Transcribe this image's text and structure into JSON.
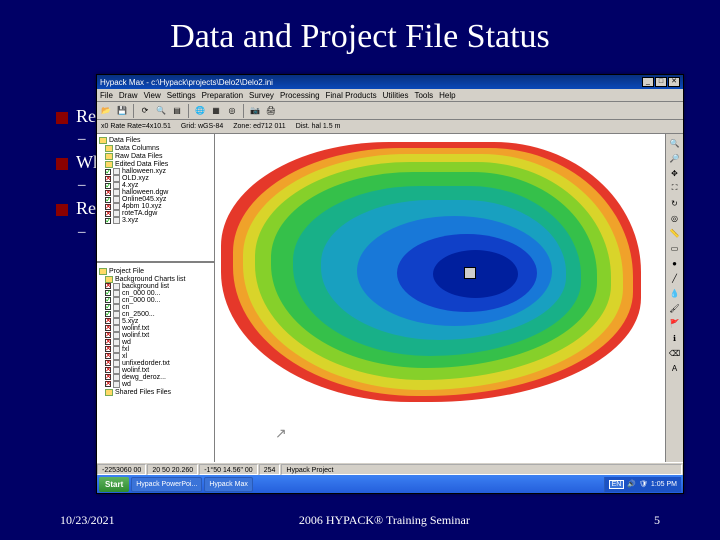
{
  "slide": {
    "title": "Data and Project File Status",
    "b1": "Red",
    "s1": "–",
    "b2": "Whi",
    "s2": "–",
    "b3": "Red",
    "s3": "–",
    "date": "10/23/2021",
    "seminar": "2006 HYPACK® Training Seminar",
    "page": "5"
  },
  "app": {
    "title": "Hypack Max - c:\\Hypack\\projects\\Delo2\\Delo2.ini",
    "menu": [
      "File",
      "Draw",
      "View",
      "Settings",
      "Preparation",
      "Survey",
      "Processing",
      "Final Products",
      "Utilities",
      "Tools",
      "Help"
    ],
    "status": {
      "s1": "x0   Rate Rate=4x10.51",
      "s2": "Grid: wGS-84",
      "s3": "Zone: ed712   011",
      "s4": "Dist. hal 1.5 m"
    },
    "tree1": {
      "root": "Data Files",
      "folders": [
        "Data Columns",
        "Raw Data Files",
        "Edited Data Files"
      ],
      "items": [
        {
          "chk": "green",
          "name": "halloween.xyz"
        },
        {
          "chk": "red",
          "name": "OLD.xyz"
        },
        {
          "chk": "green",
          "name": "4.xyz"
        },
        {
          "chk": "red",
          "name": "halloween.dgw"
        },
        {
          "chk": "green",
          "name": "Online045.xyz"
        },
        {
          "chk": "red",
          "name": "4pbm 10.xyz"
        },
        {
          "chk": "red",
          "name": "roteTA.dgw"
        },
        {
          "chk": "green",
          "name": "3.xyz"
        }
      ]
    },
    "tree2": {
      "root": "Project File",
      "folder": "Background Charts list",
      "items": [
        {
          "chk": "red",
          "name": "background list"
        },
        {
          "chk": "green",
          "name": "cn_000 00..."
        },
        {
          "chk": "green",
          "name": "cn_000 00..."
        },
        {
          "chk": "green",
          "name": "cn"
        },
        {
          "chk": "green",
          "name": "cn_2500..."
        },
        {
          "chk": "red",
          "name": "5.xyz"
        },
        {
          "chk": "red",
          "name": "wolinf.txt"
        },
        {
          "chk": "red",
          "name": "wolinf.txt"
        },
        {
          "chk": "red",
          "name": "wd"
        },
        {
          "chk": "red",
          "name": "fxl"
        },
        {
          "chk": "red",
          "name": "xl"
        },
        {
          "chk": "red",
          "name": "unfixedorder.txt"
        },
        {
          "chk": "red",
          "name": "wolinf.txt"
        },
        {
          "chk": "red",
          "name": "dewg_deroz..."
        },
        {
          "chk": "red",
          "name": "wd"
        }
      ],
      "footer": "Shared Files Files"
    },
    "statusbar": {
      "c1": "-2253060 00",
      "c2": "20 50 20.260",
      "c3": "-1°50 14.56\" 00",
      "c4": "254",
      "c5": "Hypack Project"
    },
    "taskbar": {
      "start": "Start",
      "tasks": [
        "Hypack PowerPoi...",
        "Hypack Max"
      ],
      "lang": "EN",
      "time": "1:05 PM"
    }
  }
}
